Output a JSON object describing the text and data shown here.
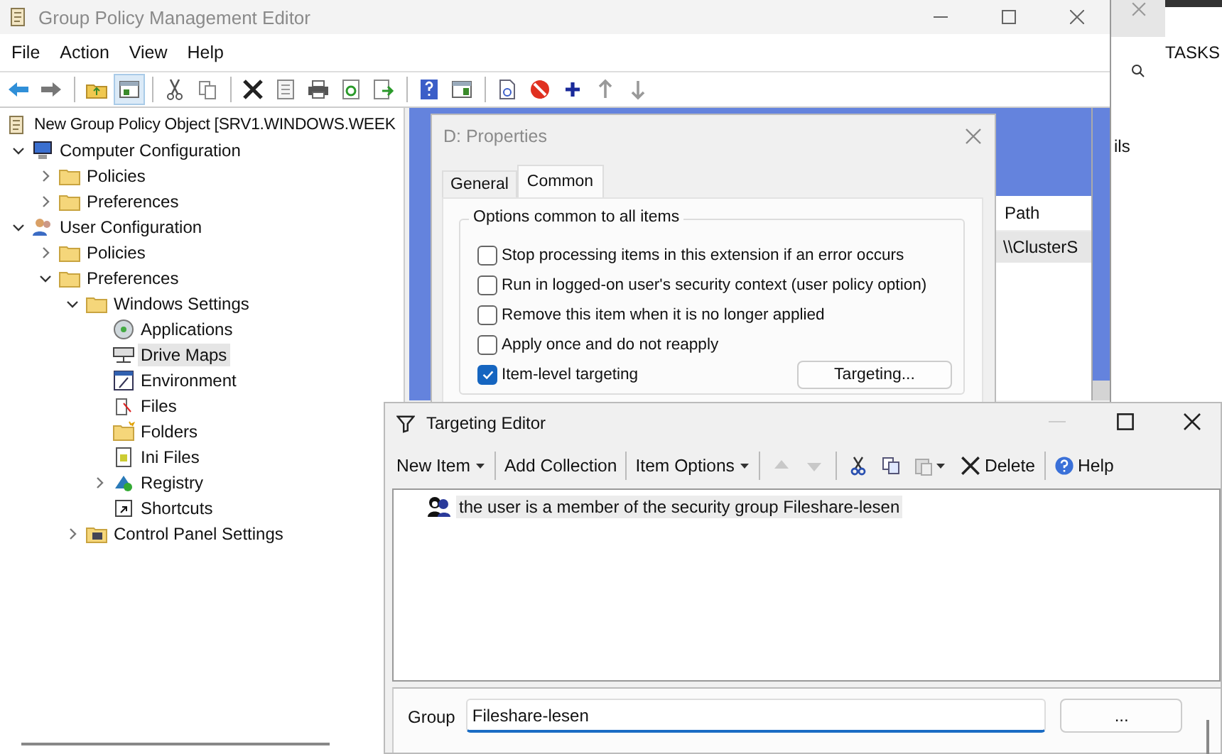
{
  "main_window": {
    "title": "Group Policy Management Editor",
    "menu": [
      "File",
      "Action",
      "View",
      "Help"
    ],
    "tree": [
      {
        "label": "New Group Policy Object [SRV1.WINDOWS.WEEK",
        "kind": "gpo",
        "selected": false,
        "children": [
          {
            "label": "Computer Configuration",
            "kind": "computer",
            "selected": false,
            "expanded": true,
            "children": [
              {
                "label": "Policies",
                "kind": "folder",
                "selected": false,
                "expanded": false
              },
              {
                "label": "Preferences",
                "kind": "folder",
                "selected": false,
                "expanded": false
              }
            ]
          },
          {
            "label": "User Configuration",
            "kind": "user",
            "selected": false,
            "expanded": true,
            "children": [
              {
                "label": "Policies",
                "kind": "folder",
                "selected": false,
                "expanded": false
              },
              {
                "label": "Preferences",
                "kind": "folder",
                "selected": false,
                "expanded": true,
                "children": [
                  {
                    "label": "Windows Settings",
                    "kind": "folder",
                    "selected": false,
                    "expanded": true,
                    "children": [
                      {
                        "label": "Applications",
                        "kind": "applications",
                        "selected": false
                      },
                      {
                        "label": "Drive Maps",
                        "kind": "drive",
                        "selected": true
                      },
                      {
                        "label": "Environment",
                        "kind": "environment",
                        "selected": false
                      },
                      {
                        "label": "Files",
                        "kind": "files",
                        "selected": false
                      },
                      {
                        "label": "Folders",
                        "kind": "folders",
                        "selected": false
                      },
                      {
                        "label": "Ini Files",
                        "kind": "ini",
                        "selected": false
                      },
                      {
                        "label": "Registry",
                        "kind": "registry",
                        "selected": false,
                        "expanded": false
                      },
                      {
                        "label": "Shortcuts",
                        "kind": "shortcut",
                        "selected": false
                      }
                    ]
                  },
                  {
                    "label": "Control Panel Settings",
                    "kind": "control-panel",
                    "selected": false,
                    "expanded": false
                  }
                ]
              }
            ]
          }
        ]
      }
    ]
  },
  "details_pane": {
    "columns": [
      "Path"
    ],
    "rows": [
      [
        "\\\\ClusterS"
      ]
    ]
  },
  "background_window": {
    "header": "TASKS",
    "partial_label": "ils"
  },
  "properties_dialog": {
    "title": "D: Properties",
    "tabs": [
      {
        "label": "General",
        "selected": false
      },
      {
        "label": "Common",
        "selected": true
      }
    ],
    "group_title": "Options common to all items",
    "options": [
      {
        "label": "Stop processing items in this extension if an error occurs",
        "checked": false
      },
      {
        "label": "Run in logged-on user's security context (user policy option)",
        "checked": false
      },
      {
        "label": "Remove this item when it is no longer applied",
        "checked": false
      },
      {
        "label": "Apply once and do not reapply",
        "checked": false
      },
      {
        "label": "Item-level targeting",
        "checked": true
      }
    ],
    "targeting_button": "Targeting..."
  },
  "targeting_editor": {
    "title": "Targeting Editor",
    "toolbar": [
      {
        "kind": "dropdown",
        "label": "New Item"
      },
      {
        "kind": "button",
        "label": "Add Collection"
      },
      {
        "kind": "dropdown",
        "label": "Item Options"
      },
      {
        "kind": "move-arrows",
        "disabled": true
      },
      {
        "kind": "clipboard"
      },
      {
        "kind": "delete",
        "label": "Delete"
      },
      {
        "kind": "help",
        "label": "Help"
      }
    ],
    "items": [
      {
        "text": "the user is a member of the security group Fileshare-lesen",
        "selected": true
      }
    ],
    "group_label": "Group",
    "group_value": "Fileshare-lesen",
    "browse_button": "..."
  }
}
